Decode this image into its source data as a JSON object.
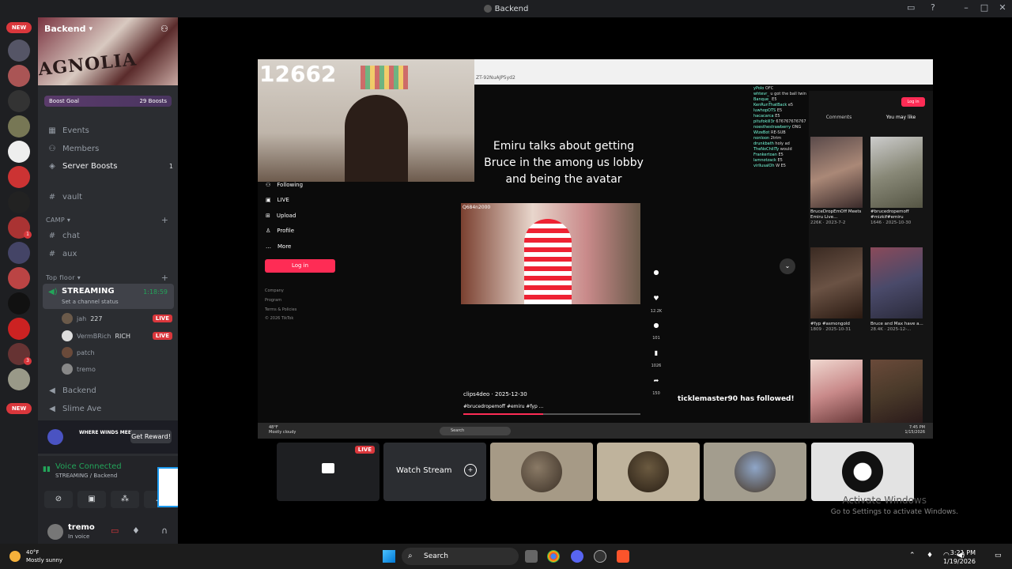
{
  "window": {
    "title": "Backend"
  },
  "servers": {
    "new_badge_top": "NEW",
    "new_badge_bottom": "NEW",
    "dot_1": "1",
    "dot_2": "3"
  },
  "server": {
    "name": "Backend",
    "banner_text": "AGNOLIA"
  },
  "boost": {
    "label": "Boost Goal",
    "count": "29 Boosts"
  },
  "nav": {
    "events": "Events",
    "members": "Members",
    "server_boosts": "Server Boosts",
    "server_boosts_count": "1",
    "vault": "vault"
  },
  "categories": {
    "camp": "CAMP",
    "top_floor": "Top floor"
  },
  "channels": {
    "chat": "chat",
    "aux": "aux",
    "backend": "Backend",
    "slime_ave": "Slime Ave"
  },
  "streaming": {
    "name": "STREAMING",
    "status": "Set a channel status",
    "time": "1:18:59",
    "users": [
      {
        "name": "jah",
        "extra": "227",
        "live": "LIVE"
      },
      {
        "name": "VermBRich",
        "extra": "RICH",
        "live": "LIVE"
      },
      {
        "name": "patch"
      },
      {
        "name": "tremo"
      }
    ]
  },
  "promo": {
    "brand": "WHERE WINDS MEET",
    "button": "Get Reward!"
  },
  "voice": {
    "title": "Voice Connected",
    "subtitle": "STREAMING / Backend"
  },
  "user": {
    "name": "tremo",
    "status": "In voice"
  },
  "stream": {
    "viewer_count": "12662",
    "url": "ZT-92NuAJP5yd2",
    "caption": "Emiru talks about getting Bruce in the among us lobby and being the avatar",
    "clip_tag": "Q684n2000",
    "tiktok_nav": [
      "Following",
      "LIVE",
      "Upload",
      "Profile",
      "More"
    ],
    "login": "Log in",
    "footer": [
      "Company",
      "Program",
      "Terms & Policies",
      "© 2026 TikTok"
    ],
    "side_counts": [
      "12.2K",
      "101",
      "1026",
      "150"
    ],
    "author": "clips4deo · 2025-12-30",
    "tags": "#brucedropemoff #emiru #fyp ...",
    "follow_alert": "ticklemaster90 has followed!",
    "tabs": [
      "Comments",
      "You may like"
    ],
    "login_small": "Log in",
    "thumbs": [
      "BruceDropEmOff Meets Emiru Live...",
      "#brucedropemoff #mizkif#emiru",
      "#fyp #asmongold",
      "Bruce and Max have a..."
    ],
    "thumb_meta": [
      "226K · 2023-7-2",
      "1646 · 2025-10-30",
      "1809 · 2025-10-31",
      "28.4K · 2025-12-..."
    ],
    "chat_lines": [
      [
        "yPolo",
        "OFC"
      ],
      [
        "whtevr_",
        "u got the ball twin"
      ],
      [
        "Banque_",
        "E5"
      ],
      [
        "KenRunThatBack",
        "e5"
      ],
      [
        "luwhopOTS",
        "E5"
      ],
      [
        "hacacarca",
        "E5"
      ],
      [
        "pitufokill3r",
        "676767676767"
      ],
      [
        "noesthestrawberry",
        "ONG"
      ],
      [
        "WizeBot",
        "RE-SUB"
      ],
      [
        "nonloon",
        "2trim"
      ],
      [
        "drunkbath",
        "holy ad"
      ],
      [
        "TheNoChillTy",
        "would"
      ],
      [
        "Frankertoan",
        "E5"
      ],
      [
        "lamnotzack",
        "E5"
      ],
      [
        "virllusalOh",
        "W E5"
      ]
    ],
    "inner_weather": "48°F\nMostly cloudy",
    "inner_search": "Search",
    "inner_clock": "7:45 PM\n1/15/2026"
  },
  "tiles": {
    "live": "LIVE",
    "watch": "Watch Stream"
  },
  "activate": {
    "title": "Activate Windows",
    "subtitle": "Go to Settings to activate Windows."
  },
  "taskbar": {
    "weather_temp": "40°F",
    "weather_desc": "Mostly sunny",
    "search": "Search",
    "time": "3:21 PM",
    "date": "1/19/2026"
  }
}
